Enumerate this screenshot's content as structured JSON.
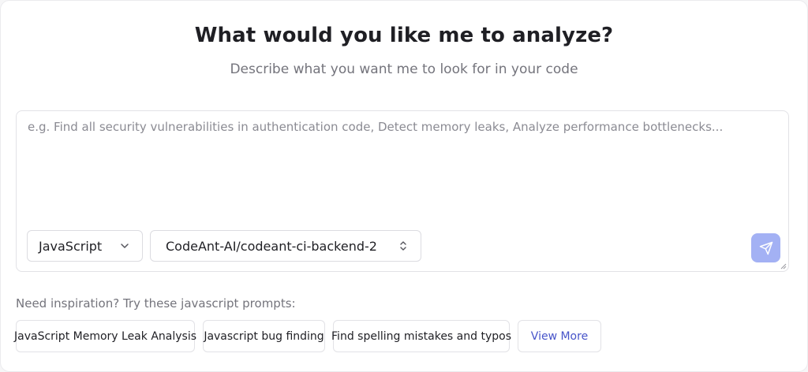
{
  "header": {
    "title": "What would you like me to analyze?",
    "subtitle": "Describe what you want me to look for in your code"
  },
  "prompt": {
    "value": "",
    "placeholder": "e.g. Find all security vulnerabilities in authentication code, Detect memory leaks, Analyze performance bottlenecks..."
  },
  "language_select": {
    "selected": "JavaScript",
    "icon": "chevron-down-icon"
  },
  "repo_select": {
    "selected": "CodeAnt-AI/codeant-ci-backend-2",
    "icon": "chevron-up-down-icon"
  },
  "send_button": {
    "icon": "send-icon",
    "color": "#a3b1f4"
  },
  "inspiration": {
    "label": "Need inspiration? Try these javascript prompts:",
    "chips": [
      "JavaScript Memory Leak Analysis",
      "Javascript bug finding",
      "Find spelling mistakes and typos"
    ],
    "view_more": "View More"
  },
  "colors": {
    "accent": "#4754c9",
    "send_button": "#a3b1f4"
  }
}
